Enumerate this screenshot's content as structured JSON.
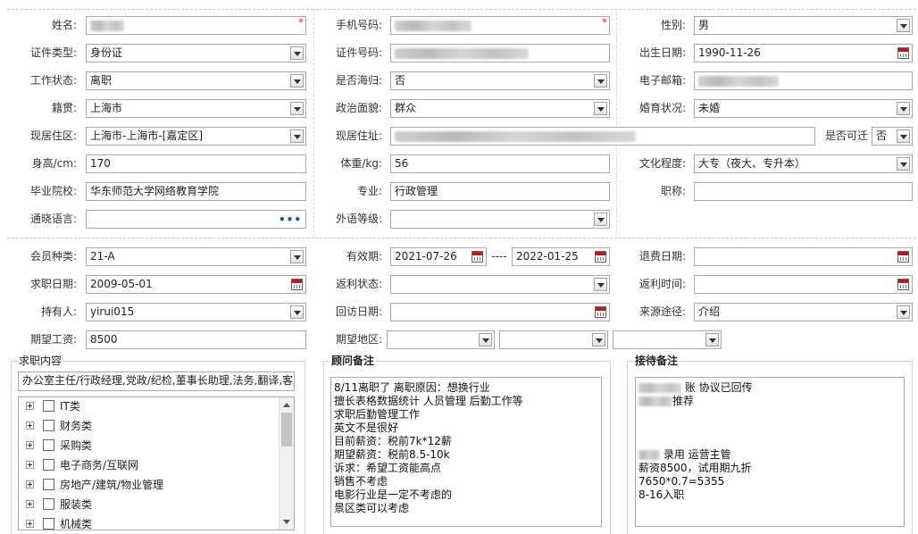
{
  "profile": {
    "name_label": "姓名:",
    "phone_label": "手机号码:",
    "gender_label": "性别:",
    "gender_value": "男",
    "idtype_label": "证件类型:",
    "idtype_value": "身份证",
    "idno_label": "证件号码:",
    "birth_label": "出生日期:",
    "birth_value": "1990-11-26",
    "workstatus_label": "工作状态:",
    "workstatus_value": "离职",
    "returnee_label": "是否海归:",
    "returnee_value": "否",
    "email_label": "电子邮箱:",
    "native_label": "籍贯:",
    "native_value": "上海市",
    "political_label": "政治面貌:",
    "political_value": "群众",
    "marital_label": "婚育状况:",
    "marital_value": "未婚",
    "residence_label": "现居住区:",
    "residence_value": "上海市-上海市-[嘉定区]",
    "address_label": "现居住址:",
    "relocate_label": "是否可迁",
    "relocate_value": "否",
    "height_label": "身高/cm:",
    "height_value": "170",
    "weight_label": "体重/kg:",
    "weight_value": "56",
    "education_label": "文化程度:",
    "education_value": "大专（夜大、专升本）",
    "school_label": "毕业院校:",
    "school_value": "华东师范大学网络教育学院",
    "major_label": "专业:",
    "major_value": "行政管理",
    "title_label": "职称:",
    "language_label": "通晓语言:",
    "foreign_label": "外语等级:",
    "required_mark": "*"
  },
  "membership": {
    "type_label": "会员种类:",
    "type_value": "21-A",
    "valid_label": "有效期:",
    "valid_from": "2021-07-26",
    "valid_sep": "----",
    "valid_to": "2022-01-25",
    "refund_date_label": "退费日期:",
    "jobdate_label": "求职日期:",
    "jobdate_value": "2009-05-01",
    "rebate_status_label": "返利状态:",
    "rebate_time_label": "返利时间:",
    "holder_label": "持有人:",
    "holder_value": "yirui015",
    "visit_label": "回访日期:",
    "source_label": "来源途径:",
    "source_value": "介绍",
    "salary_label": "期望工资:",
    "salary_value": "8500",
    "region_label": "期望地区:"
  },
  "job_content": {
    "title": "求职内容",
    "summary": "办公室主任/行政经理,党政/纪检,董事长助理,法务,翻译,客服",
    "categories": [
      "IT类",
      "财务类",
      "采购类",
      "电子商务/互联网",
      "房地产/建筑/物业管理",
      "服装类",
      "机械类"
    ]
  },
  "consultant_notes": {
    "title": "顾问备注",
    "lines": [
      "8/11离职了 离职原因：想换行业",
      "擅长表格数据统计 人员管理  后勤工作等",
      "求职后勤管理工作",
      "英文不是很好",
      "目前薪资：税前7k*12薪",
      "期望薪资：税前8.5-10k",
      "诉求：希望工资能高点",
      "销售不考虑",
      "电影行业是一定不考虑的",
      "景区类可以考虑"
    ]
  },
  "reception_notes": {
    "title": "接待备注",
    "line1": "账 协议已回传",
    "line2": "推荐",
    "line3": "录用  运营主管",
    "line4": "薪资8500，试用期九折",
    "line5": "7650*0.7=5355",
    "line6": "8-16入职"
  },
  "icons": {
    "dropdown": "chevron-down-icon",
    "calendar": "calendar-icon",
    "more": "ellipsis-icon",
    "expand": "plus-box-icon"
  },
  "colors": {
    "required": "#e02020",
    "border": "#a8a8a8",
    "calendar": "#b02020"
  }
}
